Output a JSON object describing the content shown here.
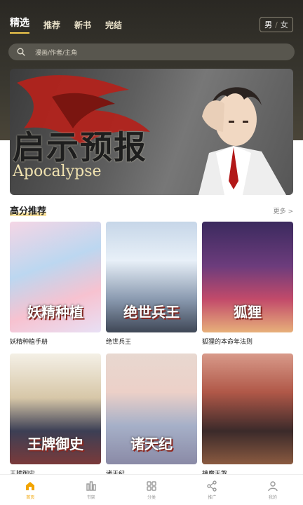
{
  "header": {
    "tabs": [
      {
        "label": "精选",
        "active": true
      },
      {
        "label": "推荐",
        "active": false
      },
      {
        "label": "新书",
        "active": false
      },
      {
        "label": "完结",
        "active": false
      }
    ],
    "gender": {
      "male": "男",
      "separator": "/",
      "female": "女",
      "selected": "male"
    }
  },
  "search": {
    "placeholder": "漫画/作者/主角",
    "icon": "search-icon"
  },
  "banner": {
    "title_cn": "启示预报",
    "title_en": "Apocalypse"
  },
  "section": {
    "title": "高分推荐",
    "more": "更多 >"
  },
  "comics": [
    {
      "title": "妖精种植手册",
      "cover_text": "妖精种植"
    },
    {
      "title": "绝世兵王",
      "cover_text": "绝世兵王"
    },
    {
      "title": "狐狸的本命年法则",
      "cover_text": "狐狸"
    },
    {
      "title": "王牌御史",
      "cover_text": "王牌御史"
    },
    {
      "title": "诸天纪",
      "cover_text": "诸天纪"
    },
    {
      "title": "神魔天煞",
      "cover_text": ""
    }
  ],
  "tabbar": [
    {
      "label": "首页",
      "icon": "home-icon",
      "active": true
    },
    {
      "label": "书架",
      "icon": "bookshelf-icon",
      "active": false
    },
    {
      "label": "分类",
      "icon": "category-icon",
      "active": false
    },
    {
      "label": "推广",
      "icon": "share-icon",
      "active": false
    },
    {
      "label": "我的",
      "icon": "profile-icon",
      "active": false
    }
  ],
  "colors": {
    "accent": "#f2a400",
    "header_bg": "#2a2823",
    "highlight": "#f2c94c"
  }
}
